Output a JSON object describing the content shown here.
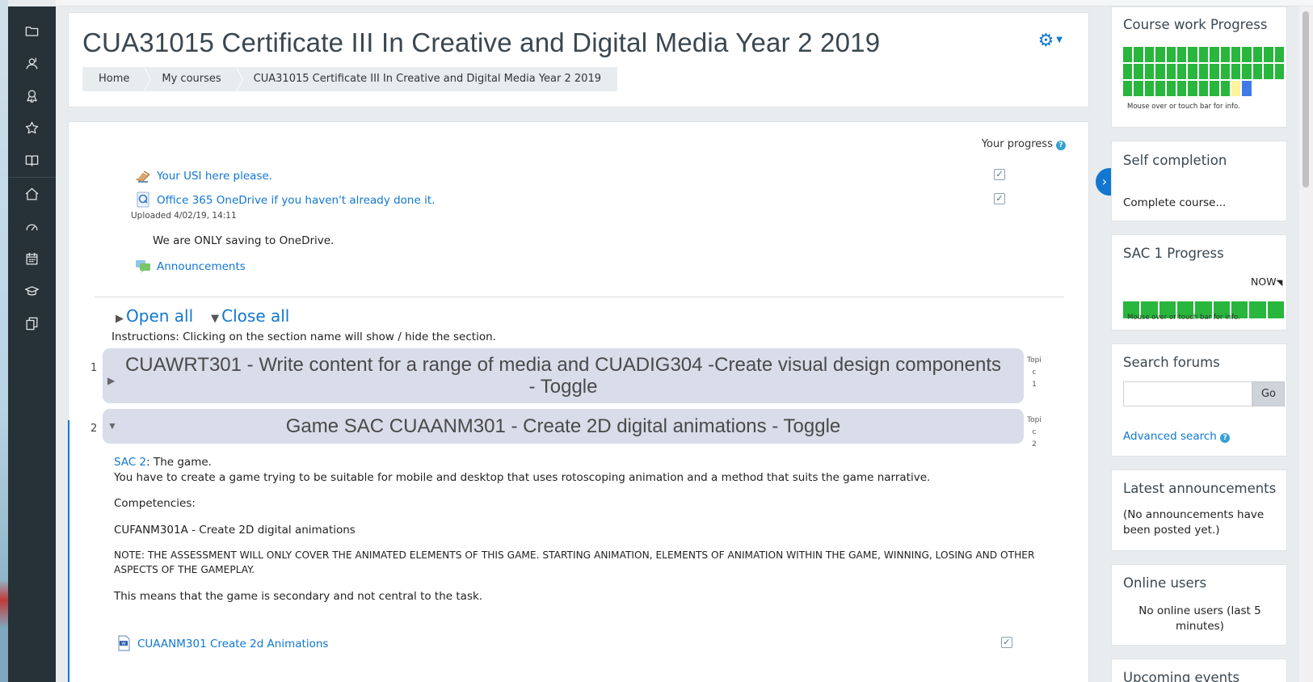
{
  "header": {
    "title": "CUA31015 Certificate III In Creative and Digital Media Year 2 2019",
    "breadcrumb": [
      "Home",
      "My courses",
      "CUA31015 Certificate III In Creative and Digital Media Year 2 2019"
    ]
  },
  "nav_icons": [
    "folder-icon",
    "contacts-icon",
    "badge-icon",
    "star-icon",
    "book-icon",
    "home-icon",
    "dashboard-icon",
    "calendar-icon",
    "graduation-cap-icon",
    "files-icon"
  ],
  "progress": {
    "label": "Your progress",
    "help": "?"
  },
  "activities": [
    {
      "label": "Your USI here please.",
      "icon": "clipboard-icon",
      "completed": true
    },
    {
      "label": "Office 365 OneDrive if you haven't already done it.",
      "icon": "url-icon",
      "completed": true,
      "meta": "Uploaded 4/02/19, 14:11",
      "note": "We are ONLY saving to OneDrive."
    },
    {
      "label": "Announcements",
      "icon": "forum-icon"
    }
  ],
  "toggles": {
    "open_all": "Open all",
    "close_all": "Close all",
    "instructions": "Instructions: Clicking on the section name will show / hide the section."
  },
  "sections": [
    {
      "number": "1",
      "title_line1": "CUAWRT301 - Write content for a range of media and CUADIG304 -Create visual design components",
      "title_line2": "- Toggle",
      "topic_label": [
        "Topi",
        "c",
        "1"
      ],
      "collapsed": true
    },
    {
      "number": "2",
      "title": "Game SAC CUAANM301 - Create 2D digital animations - Toggle",
      "topic_label": [
        "Topi",
        "c",
        "2"
      ],
      "collapsed": false,
      "sac_link": "SAC 2",
      "sac_rest": ": The game.",
      "desc": "You have to create a game trying to be suitable for mobile and desktop that uses rotoscoping animation and a method that suits the game narrative.",
      "competencies": "Competencies:",
      "unit": "CUFANM301A - Create 2D digital animations",
      "note_line1": "NOTE: THE ASSESSMENT WILL ONLY COVER THE ANIMATED ELEMENTS OF THIS GAME.  STARTING ANIMATION, ELEMENTS OF ANIMATION WITHIN THE GAME, WINNING, LOSING AND OTHER",
      "note_line2": "ASPECTS OF THE GAMEPLAY.",
      "secondary": "This means that the game is secondary and not central to the task.",
      "file_label": "CUAANM301 Create 2d Animations",
      "file_icon": "word-doc-icon",
      "file_completed": true
    }
  ],
  "blocks": {
    "coursework": {
      "title": "Course work Progress",
      "hint": "Mouse over or touch bar for info.",
      "cells": [
        "g",
        "g",
        "g",
        "g",
        "g",
        "g",
        "g",
        "g",
        "g",
        "g",
        "g",
        "g",
        "g",
        "g",
        "g",
        "g",
        "g",
        "g",
        "g",
        "g",
        "g",
        "g",
        "g",
        "g",
        "g",
        "g",
        "g",
        "g",
        "g",
        "g",
        "g",
        "g",
        "g",
        "g",
        "g",
        "g",
        "g",
        "g",
        "g",
        "g",
        "y",
        "b"
      ],
      "colors": {
        "g": "#28b63c",
        "y": "#fbf49b",
        "b": "#3f7be6"
      }
    },
    "self_completion": {
      "title": "Self completion",
      "link": "Complete course..."
    },
    "sac1": {
      "title": "SAC 1 Progress",
      "now": "NOW",
      "segments": 9,
      "hint": "Mouse over or touch bar for info."
    },
    "search_forums": {
      "title": "Search forums",
      "go": "Go",
      "advanced": "Advanced search",
      "help": "?"
    },
    "latest_announcements": {
      "title": "Latest announcements",
      "text": "(No announcements have been posted yet.)"
    },
    "online_users": {
      "title": "Online users",
      "text": "No online users (last 5 minutes)"
    },
    "upcoming_events": {
      "title": "Upcoming events"
    }
  },
  "drawer_toggle": "›",
  "gear": "⚙"
}
